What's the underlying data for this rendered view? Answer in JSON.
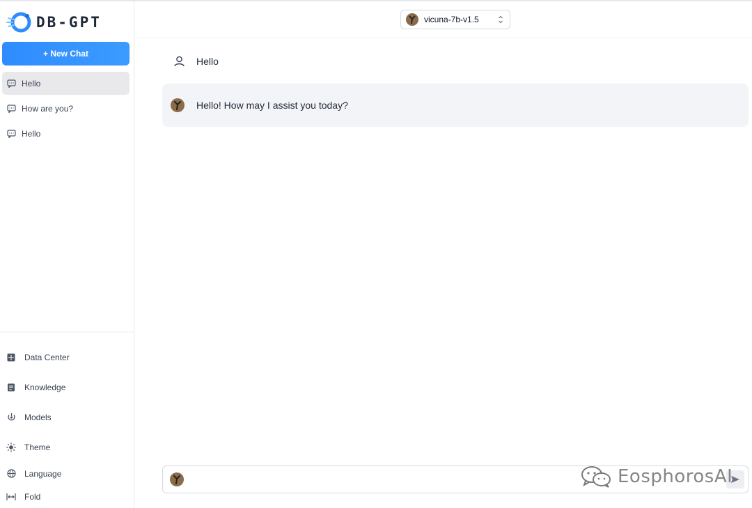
{
  "app": {
    "logo_text": "DB-GPT"
  },
  "sidebar": {
    "new_chat_label": "+ New Chat",
    "conversations": [
      {
        "label": "Hello",
        "active": true
      },
      {
        "label": "How are you?",
        "active": false
      },
      {
        "label": "Hello",
        "active": false
      }
    ],
    "menu": [
      {
        "label": "Data Center",
        "icon": "grid-icon"
      },
      {
        "label": "Knowledge",
        "icon": "document-icon"
      },
      {
        "label": "Models",
        "icon": "model-icon"
      },
      {
        "label": "Theme",
        "icon": "sun-icon"
      },
      {
        "label": "Language",
        "icon": "globe-icon"
      },
      {
        "label": "Fold",
        "icon": "fold-icon"
      }
    ]
  },
  "header": {
    "model_name": "vicuna-7b-v1.5"
  },
  "chat": {
    "messages": [
      {
        "role": "user",
        "text": "Hello"
      },
      {
        "role": "assistant",
        "text": "Hello! How may I assist you today?"
      }
    ]
  },
  "composer": {
    "value": "",
    "placeholder": ""
  },
  "watermark": {
    "text": "EosphorosAI"
  },
  "colors": {
    "accent": "#2f8cff",
    "assistant_bg": "#f3f4f8",
    "active_item_bg": "#e9e9ec"
  }
}
